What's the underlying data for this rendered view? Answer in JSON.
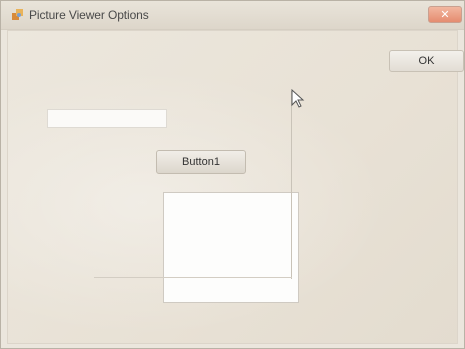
{
  "window": {
    "title": "Picture Viewer Options",
    "close_label": "✕",
    "app_icon": "app-icon"
  },
  "buttons": {
    "ok_label": "OK",
    "button1_label": "Button1"
  },
  "text_field": {
    "value": ""
  },
  "colors": {
    "background": "#ebe6dd",
    "close_button": "#e58c70"
  },
  "cursor": {
    "icon": "mouse-pointer-icon"
  }
}
